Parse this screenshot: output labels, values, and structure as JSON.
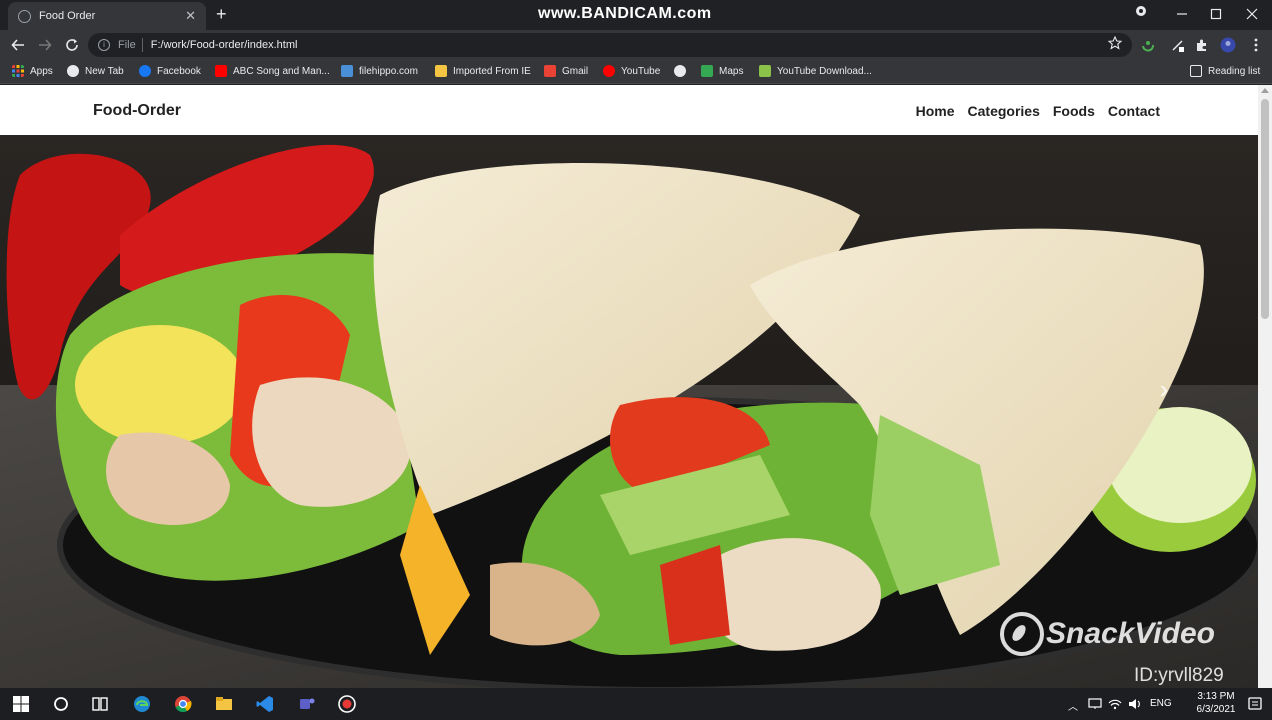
{
  "browser": {
    "tab_title": "Food Order",
    "new_tab_symbol": "+",
    "close_tab_symbol": "✕",
    "recorder_watermark": "www.BANDICAM.com",
    "scheme_label": "File",
    "url": "F:/work/Food-order/index.html"
  },
  "bookmarks": [
    {
      "label": "Apps",
      "color": "#e8eaed"
    },
    {
      "label": "New Tab",
      "color": "#e8eaed"
    },
    {
      "label": "Facebook",
      "color": "#1877f2"
    },
    {
      "label": "ABC Song and Man...",
      "color": "#ff0000"
    },
    {
      "label": "filehippo.com",
      "color": "#4a90d9"
    },
    {
      "label": "Imported From IE",
      "color": "#f4c542"
    },
    {
      "label": "Gmail",
      "color": "#ea4335"
    },
    {
      "label": "YouTube",
      "color": "#ff0000"
    },
    {
      "label": "",
      "color": "#e8eaed"
    },
    {
      "label": "Maps",
      "color": "#34a853"
    },
    {
      "label": "YouTube Download...",
      "color": "#8bc34a"
    }
  ],
  "reading_list": "Reading list",
  "site": {
    "brand": "Food-Order",
    "nav": [
      "Home",
      "Categories",
      "Foods",
      "Contact"
    ],
    "next_arrow": "›"
  },
  "overlay": {
    "snack_video": "SnackVideo",
    "snack_id": "ID:yrvll829"
  },
  "taskbar": {
    "lang": "ENG",
    "time": "3:13 PM",
    "date": "6/3/2021"
  },
  "colors": {
    "chrome_dark": "#202124",
    "chrome_toolbar": "#35363a",
    "page_bg": "#ffffff",
    "text_dark": "#222222"
  }
}
